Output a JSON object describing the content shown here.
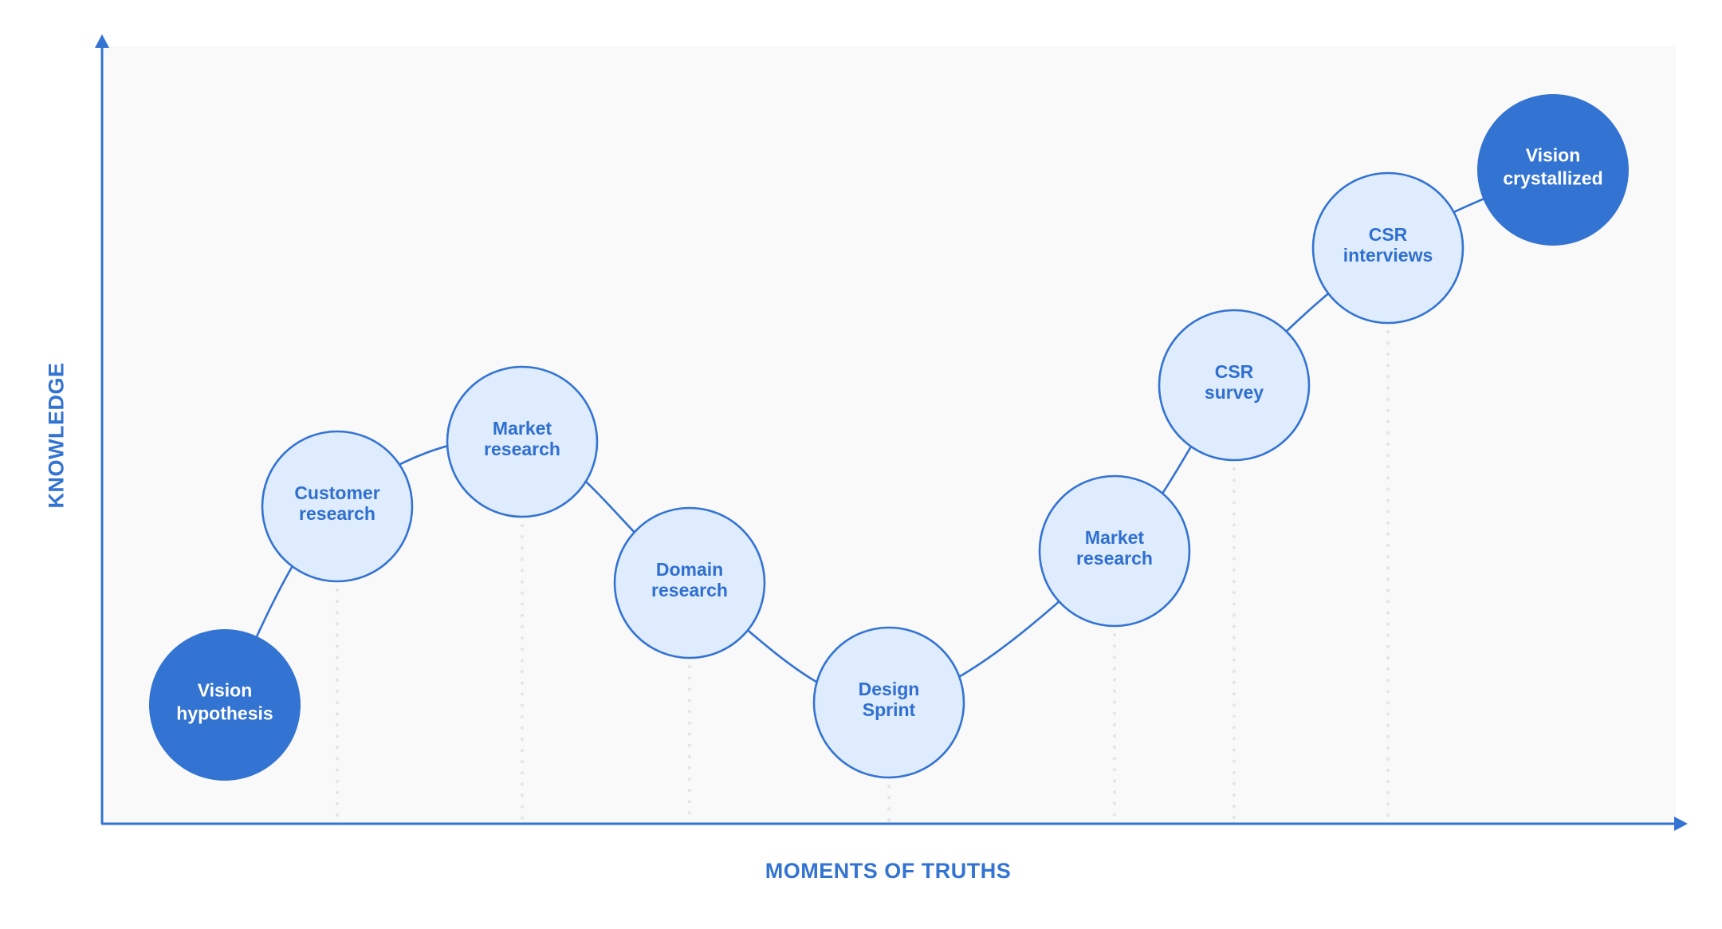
{
  "diagram": {
    "type": "journey-curve",
    "x_axis": {
      "label": "MOMENTS OF TRUTHS"
    },
    "y_axis": {
      "label": "KNOWLEDGE"
    },
    "colors": {
      "accent": "#3373d2",
      "node_fill_light": "#dfecfd",
      "node_text_light": "#2f6fcf",
      "node_text_dark": "#ffffff",
      "plot_background": "#f9f9f9",
      "guide_dots": "#e4e4e4"
    },
    "nodes": [
      {
        "id": "vision-hypothesis",
        "lines": [
          "Vision",
          "hypothesis"
        ],
        "variant": "dark",
        "guide": false
      },
      {
        "id": "customer-research",
        "lines": [
          "Customer",
          "research"
        ],
        "variant": "light",
        "guide": true
      },
      {
        "id": "market-research-1",
        "lines": [
          "Market",
          "research"
        ],
        "variant": "light",
        "guide": true
      },
      {
        "id": "domain-research",
        "lines": [
          "Domain",
          "research"
        ],
        "variant": "light",
        "guide": true
      },
      {
        "id": "design-sprint",
        "lines": [
          "Design",
          "Sprint"
        ],
        "variant": "light",
        "guide": true
      },
      {
        "id": "market-research-2",
        "lines": [
          "Market",
          "research"
        ],
        "variant": "light",
        "guide": true
      },
      {
        "id": "csr-survey",
        "lines": [
          "CSR",
          "survey"
        ],
        "variant": "light",
        "guide": true
      },
      {
        "id": "csr-interviews",
        "lines": [
          "CSR",
          "interviews"
        ],
        "variant": "light",
        "guide": true
      },
      {
        "id": "vision-crystallized",
        "lines": [
          "Vision",
          "crystallized"
        ],
        "variant": "dark",
        "guide": false
      }
    ]
  }
}
